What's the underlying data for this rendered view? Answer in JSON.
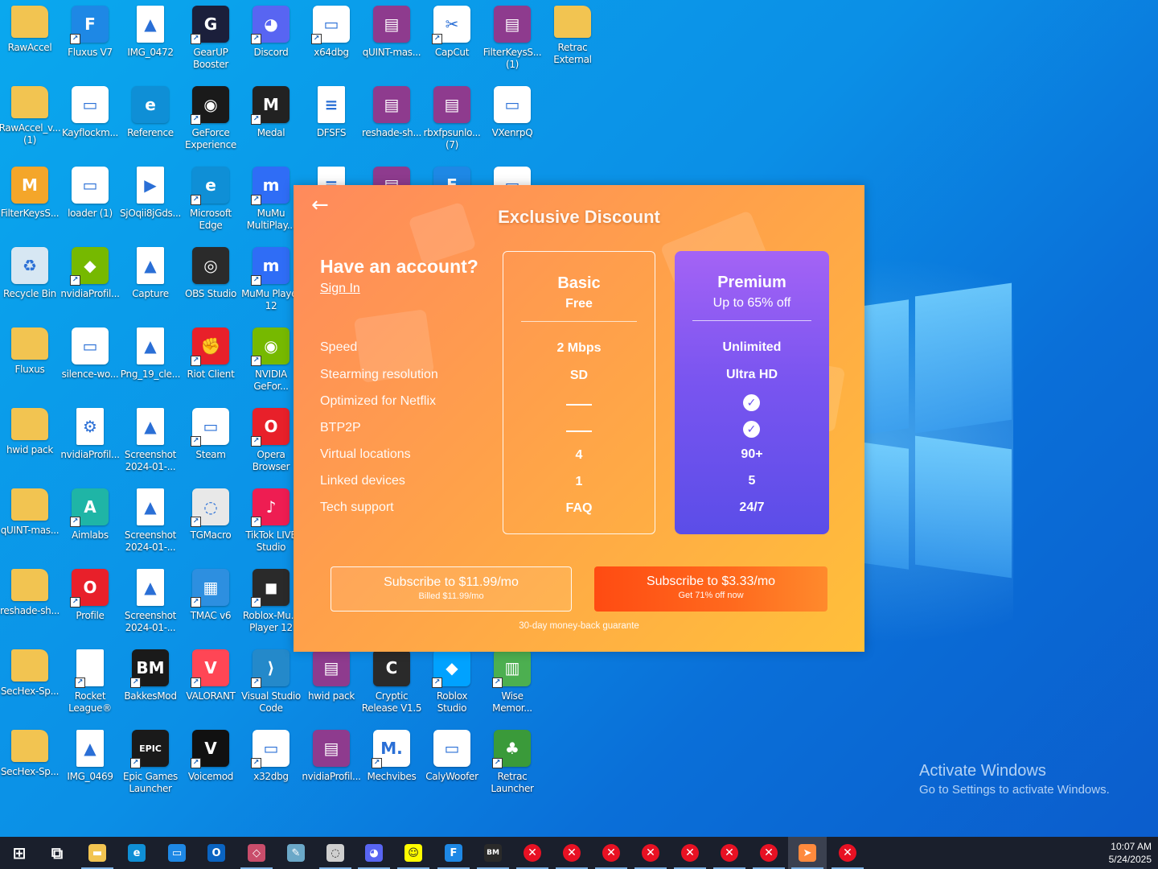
{
  "desktop": {
    "icons": [
      {
        "label": "RawAccel",
        "glyph": "folder-icon",
        "color": "#f2c451",
        "sym": "",
        "shortcut": false
      },
      {
        "label": "Fluxus V7",
        "glyph": "shield-app-icon",
        "color": "#1e88e5",
        "sym": "F",
        "shortcut": true
      },
      {
        "label": "IMG_0472",
        "glyph": "image-file-icon",
        "color": "#ffffff",
        "sym": "▲",
        "shortcut": false
      },
      {
        "label": "GearUP Booster",
        "glyph": "gearup-icon",
        "color": "#1b1f3b",
        "sym": "G",
        "shortcut": true
      },
      {
        "label": "Discord",
        "glyph": "discord-icon",
        "color": "#5865f2",
        "sym": "◕",
        "shortcut": true
      },
      {
        "label": "x64dbg",
        "glyph": "window-app-icon",
        "color": "#ffffff",
        "sym": "▭",
        "shortcut": true
      },
      {
        "label": "qUINT-mas...",
        "glyph": "winrar-icon",
        "color": "#8e3b8e",
        "sym": "▤",
        "shortcut": false
      },
      {
        "label": "CapCut",
        "glyph": "capcut-icon",
        "color": "#ffffff",
        "sym": "✂",
        "shortcut": true
      },
      {
        "label": "FilterKeysS... (1)",
        "glyph": "winrar-icon",
        "color": "#8e3b8e",
        "sym": "▤",
        "shortcut": false
      },
      {
        "label": "Retrac External",
        "glyph": "folder-icon",
        "color": "#f2c451",
        "sym": "",
        "shortcut": false
      },
      {
        "label": "RawAccel_v... (1)",
        "glyph": "folder-icon",
        "color": "#f2c451",
        "sym": "",
        "shortcut": false
      },
      {
        "label": "Kayflockm...",
        "glyph": "window-app-icon",
        "color": "#ffffff",
        "sym": "▭",
        "shortcut": false
      },
      {
        "label": "Reference",
        "glyph": "edge-icon",
        "color": "#0f8fd6",
        "sym": "e",
        "shortcut": false
      },
      {
        "label": "GeForce Experience",
        "glyph": "nvidia-icon",
        "color": "#1a1a1a",
        "sym": "◉",
        "shortcut": true
      },
      {
        "label": "Medal",
        "glyph": "medal-icon",
        "color": "#222222",
        "sym": "M",
        "shortcut": true
      },
      {
        "label": "DFSFS",
        "glyph": "text-file-icon",
        "color": "#ffffff",
        "sym": "≡",
        "shortcut": false
      },
      {
        "label": "reshade-sh...",
        "glyph": "winrar-icon",
        "color": "#8e3b8e",
        "sym": "▤",
        "shortcut": false
      },
      {
        "label": "rbxfpsunlo... (7)",
        "glyph": "winrar-icon",
        "color": "#8e3b8e",
        "sym": "▤",
        "shortcut": false
      },
      {
        "label": "VXenrpQ",
        "glyph": "window-app-icon",
        "color": "#ffffff",
        "sym": "▭",
        "shortcut": false
      },
      {
        "label": "FilterKeysS...",
        "glyph": "mfc-icon",
        "color": "#f4a62a",
        "sym": "M",
        "shortcut": false
      },
      {
        "label": "loader (1)",
        "glyph": "window-app-icon",
        "color": "#ffffff",
        "sym": "▭",
        "shortcut": false
      },
      {
        "label": "SjOqii8jGds...",
        "glyph": "media-file-icon",
        "color": "#ffffff",
        "sym": "▶",
        "shortcut": false
      },
      {
        "label": "Microsoft Edge",
        "glyph": "edge-icon",
        "color": "#0f8fd6",
        "sym": "e",
        "shortcut": true
      },
      {
        "label": "MuMu MultiPlay...",
        "glyph": "mumu-icon",
        "color": "#2f6df6",
        "sym": "m",
        "shortcut": true
      },
      {
        "label": "Recycle Bin",
        "glyph": "recycle-bin-icon",
        "color": "#d7e7f3",
        "sym": "♻",
        "shortcut": false
      },
      {
        "label": "nvidiaProfil...",
        "glyph": "nvidia-inspector-icon",
        "color": "#76b900",
        "sym": "◆",
        "shortcut": true
      },
      {
        "label": "Capture",
        "glyph": "image-file-icon",
        "color": "#ffffff",
        "sym": "▲",
        "shortcut": false
      },
      {
        "label": "OBS Studio",
        "glyph": "obs-icon",
        "color": "#2b2b2b",
        "sym": "◎",
        "shortcut": false
      },
      {
        "label": "MuMu Player 12",
        "glyph": "mumu-icon",
        "color": "#2f6df6",
        "sym": "m",
        "shortcut": true
      },
      {
        "label": "Fluxus",
        "glyph": "folder-icon",
        "color": "#f2c451",
        "sym": "",
        "shortcut": false
      },
      {
        "label": "silence-wo...",
        "glyph": "shield-app-icon",
        "color": "#ffffff",
        "sym": "▭",
        "shortcut": false
      },
      {
        "label": "Png_19_cle...",
        "glyph": "image-file-icon",
        "color": "#ffffff",
        "sym": "▲",
        "shortcut": false
      },
      {
        "label": "Riot Client",
        "glyph": "riot-icon",
        "color": "#e8202a",
        "sym": "✊",
        "shortcut": true
      },
      {
        "label": "NVIDIA GeFor...",
        "glyph": "nvidia-icon",
        "color": "#76b900",
        "sym": "◉",
        "shortcut": true
      },
      {
        "label": "hwid pack",
        "glyph": "folder-icon",
        "color": "#f2c451",
        "sym": "",
        "shortcut": false
      },
      {
        "label": "nvidiaProfil...",
        "glyph": "gear-file-icon",
        "color": "#ffffff",
        "sym": "⚙",
        "shortcut": false
      },
      {
        "label": "Screenshot 2024-01-...",
        "glyph": "image-file-icon",
        "color": "#ffffff",
        "sym": "▲",
        "shortcut": false
      },
      {
        "label": "Steam",
        "glyph": "window-app-icon",
        "color": "#ffffff",
        "sym": "▭",
        "shortcut": true
      },
      {
        "label": "Opera Browser",
        "glyph": "opera-icon",
        "color": "#e8202a",
        "sym": "O",
        "shortcut": true
      },
      {
        "label": "qUINT-mas...",
        "glyph": "folder-icon",
        "color": "#f2c451",
        "sym": "",
        "shortcut": false
      },
      {
        "label": "Aimlabs",
        "glyph": "aimlabs-icon",
        "color": "#1fb5a6",
        "sym": "A",
        "shortcut": true
      },
      {
        "label": "Screenshot 2024-01-...",
        "glyph": "image-file-icon",
        "color": "#ffffff",
        "sym": "▲",
        "shortcut": false
      },
      {
        "label": "TGMacro",
        "glyph": "tgmacro-icon",
        "color": "#e8e8e8",
        "sym": "◌",
        "shortcut": true
      },
      {
        "label": "TikTok LIVE Studio",
        "glyph": "tiktok-icon",
        "color": "#ee1d52",
        "sym": "♪",
        "shortcut": true
      },
      {
        "label": "reshade-sh...",
        "glyph": "folder-icon",
        "color": "#f2c451",
        "sym": "",
        "shortcut": false
      },
      {
        "label": "Profile",
        "glyph": "opera-icon",
        "color": "#e8202a",
        "sym": "O",
        "shortcut": true
      },
      {
        "label": "Screenshot 2024-01-...",
        "glyph": "image-file-icon",
        "color": "#ffffff",
        "sym": "▲",
        "shortcut": false
      },
      {
        "label": "TMAC v6",
        "glyph": "tmac-icon",
        "color": "#2d8fe0",
        "sym": "▦",
        "shortcut": true
      },
      {
        "label": "Roblox-Mu... Player 12",
        "glyph": "roblox-icon",
        "color": "#2a2a2a",
        "sym": "◼",
        "shortcut": true
      },
      {
        "label": "SecHex-Sp...",
        "glyph": "folder-icon",
        "color": "#f2c451",
        "sym": "",
        "shortcut": false
      },
      {
        "label": "Rocket League®",
        "glyph": "blank-file-icon",
        "color": "#ffffff",
        "sym": "",
        "shortcut": true
      },
      {
        "label": "BakkesMod",
        "glyph": "bakkesmod-icon",
        "color": "#1a1a1a",
        "sym": "BM",
        "shortcut": true
      },
      {
        "label": "VALORANT",
        "glyph": "valorant-icon",
        "color": "#ff4655",
        "sym": "V",
        "shortcut": true
      },
      {
        "label": "Visual Studio Code",
        "glyph": "vscode-icon",
        "color": "#2489ca",
        "sym": "⟩",
        "shortcut": true
      },
      {
        "label": "hwid pack",
        "glyph": "winrar-icon",
        "color": "#8e3b8e",
        "sym": "▤",
        "shortcut": false
      },
      {
        "label": "Cryptic Release V1.5",
        "glyph": "cryptic-icon",
        "color": "#2a2a2a",
        "sym": "C",
        "shortcut": false
      },
      {
        "label": "Roblox Studio",
        "glyph": "roblox-studio-icon",
        "color": "#00a2ff",
        "sym": "◆",
        "shortcut": true
      },
      {
        "label": "Wise Memor...",
        "glyph": "wise-memory-icon",
        "color": "#4caf50",
        "sym": "▥",
        "shortcut": true
      },
      {
        "label": "SecHex-Sp...",
        "glyph": "folder-icon",
        "color": "#f2c451",
        "sym": "",
        "shortcut": false
      },
      {
        "label": "IMG_0469",
        "glyph": "image-file-icon",
        "color": "#ffffff",
        "sym": "▲",
        "shortcut": false
      },
      {
        "label": "Epic Games Launcher",
        "glyph": "epic-games-icon",
        "color": "#1a1a1a",
        "sym": "EPIC",
        "shortcut": true
      },
      {
        "label": "Voicemod",
        "glyph": "voicemod-icon",
        "color": "#111111",
        "sym": "V",
        "shortcut": true
      },
      {
        "label": "x32dbg",
        "glyph": "window-app-icon",
        "color": "#ffffff",
        "sym": "▭",
        "shortcut": true
      },
      {
        "label": "nvidiaProfil...",
        "glyph": "winrar-icon",
        "color": "#8e3b8e",
        "sym": "▤",
        "shortcut": false
      },
      {
        "label": "Mechvibes",
        "glyph": "mechvibes-icon",
        "color": "#ffffff",
        "sym": "M.",
        "shortcut": true
      },
      {
        "label": "CalyWoofer",
        "glyph": "shield-app-icon",
        "color": "#ffffff",
        "sym": "▭",
        "shortcut": false
      },
      {
        "label": "Retrac Launcher",
        "glyph": "retrac-icon",
        "color": "#3a9a3a",
        "sym": "♣",
        "shortcut": true
      },
      {
        "label": "",
        "glyph": "text-file-icon",
        "color": "#ffffff",
        "sym": "≡",
        "shortcut": false
      },
      {
        "label": "",
        "glyph": "winrar-icon",
        "color": "#8e3b8e",
        "sym": "▤",
        "shortcut": false
      },
      {
        "label": "",
        "glyph": "shield-app-icon",
        "color": "#1e88e5",
        "sym": "F",
        "shortcut": false
      },
      {
        "label": "",
        "glyph": "window-app-icon",
        "color": "#ffffff",
        "sym": "▭",
        "shortcut": false
      }
    ]
  },
  "popup": {
    "back_label": "←",
    "title": "Exclusive Discount",
    "account_title": "Have an account?",
    "signin_label": "Sign In",
    "features": [
      "Speed",
      "Stearming resolution",
      "Optimized for Netflix",
      "BTP2P",
      "Virtual locations",
      "Linked devices",
      "Tech support"
    ],
    "basic": {
      "name": "Basic",
      "sub": "Free",
      "values": [
        "2 Mbps",
        "SD",
        "dash",
        "dash",
        "4",
        "1",
        "FAQ"
      ]
    },
    "premium": {
      "name": "Premium",
      "sub": "Up to 65% off",
      "values": [
        "Unlimited",
        "Ultra HD",
        "check",
        "check",
        "90+",
        "5",
        "24/7"
      ]
    },
    "buttons": {
      "basic_main": "Subscribe to $11.99/mo",
      "basic_note": "Billed $11.99/mo",
      "premium_main": "Subscribe to $3.33/mo",
      "premium_note": "Get 71% off now"
    },
    "guarantee": "30-day money-back guarante",
    "colors": {
      "orange": "#ffa14a",
      "premium_purple": "#7a55f0",
      "cta_red": "#ff4b12"
    }
  },
  "watermark": {
    "line1": "Activate Windows",
    "line2": "Go to Settings to activate Windows."
  },
  "taskbar": {
    "items": [
      {
        "name": "start-icon",
        "sym": "⊞",
        "color": "#ffffff",
        "kind": "plain"
      },
      {
        "name": "task-view-icon",
        "sym": "⧉",
        "color": "#ffffff",
        "kind": "plain"
      },
      {
        "name": "file-explorer-icon",
        "sym": "▬",
        "color": "#f2c451",
        "kind": "box"
      },
      {
        "name": "edge-icon",
        "sym": "e",
        "color": "#0f8fd6",
        "kind": "box"
      },
      {
        "name": "window-app-icon",
        "sym": "▭",
        "color": "#1e88e5",
        "kind": "box"
      },
      {
        "name": "outlook-icon",
        "sym": "O",
        "color": "#0a64c2",
        "kind": "box"
      },
      {
        "name": "gearup-icon",
        "sym": "◇",
        "color": "#c94d6b",
        "kind": "box"
      },
      {
        "name": "pen-app-icon",
        "sym": "✎",
        "color": "#6ba8c8",
        "kind": "box"
      },
      {
        "name": "tgmacro-icon",
        "sym": "◌",
        "color": "#cfcfcf",
        "kind": "box"
      },
      {
        "name": "discord-icon",
        "sym": "◕",
        "color": "#5865f2",
        "kind": "box"
      },
      {
        "name": "snapchat-icon",
        "sym": "☺",
        "color": "#fffc00",
        "kind": "box"
      },
      {
        "name": "fluxus-icon",
        "sym": "F",
        "color": "#1e88e5",
        "kind": "box"
      },
      {
        "name": "bakkesmod-icon",
        "sym": "BM",
        "color": "#2a2a2a",
        "kind": "box"
      },
      {
        "name": "error-icon",
        "sym": "✕",
        "color": "#e81123",
        "kind": "x"
      },
      {
        "name": "error-icon",
        "sym": "✕",
        "color": "#e81123",
        "kind": "x"
      },
      {
        "name": "error-icon",
        "sym": "✕",
        "color": "#e81123",
        "kind": "x"
      },
      {
        "name": "error-icon",
        "sym": "✕",
        "color": "#e81123",
        "kind": "x"
      },
      {
        "name": "error-icon",
        "sym": "✕",
        "color": "#e81123",
        "kind": "x"
      },
      {
        "name": "error-icon",
        "sym": "✕",
        "color": "#e81123",
        "kind": "x"
      },
      {
        "name": "error-icon",
        "sym": "✕",
        "color": "#e81123",
        "kind": "x"
      },
      {
        "name": "vpn-app-icon",
        "sym": "➤",
        "color": "#ff8a3d",
        "kind": "box"
      },
      {
        "name": "error-icon",
        "sym": "✕",
        "color": "#e81123",
        "kind": "x"
      }
    ],
    "time": "10:07 AM",
    "date": "5/24/2025"
  }
}
